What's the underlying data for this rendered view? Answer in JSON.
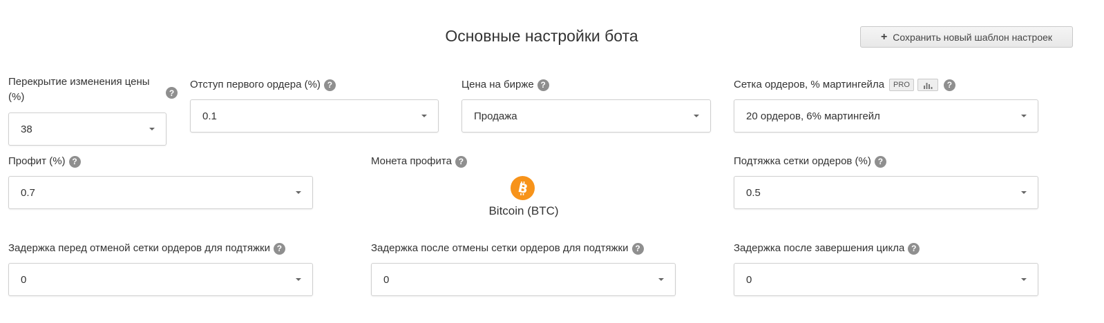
{
  "header": {
    "title": "Основные настройки бота",
    "save_button": "Сохранить новый шаблон настроек",
    "save_icon": "plus-icon"
  },
  "fields": {
    "overlap": {
      "label": "Перекрытие изменения цены (%)",
      "value": "38"
    },
    "first_order_offset": {
      "label": "Отступ первого ордера (%)",
      "value": "0.1"
    },
    "exchange_price": {
      "label": "Цена на бирже",
      "value": "Продажа"
    },
    "order_grid": {
      "label": "Сетка ордеров, % мартингейла",
      "badge": "PRO",
      "chart_icon": "bar-chart-icon",
      "value": "20 ордеров, 6% мартингейл"
    },
    "profit": {
      "label": "Профит (%)",
      "value": "0.7"
    },
    "profit_coin": {
      "label": "Монета профита",
      "coin_name": "Bitcoin (BTC)",
      "coin_icon": "bitcoin-icon",
      "coin_color": "#f7931a"
    },
    "grid_pullup": {
      "label": "Подтяжка сетки ордеров (%)",
      "value": "0.5"
    },
    "delay_before_cancel": {
      "label": "Задержка перед отменой сетки ордеров для подтяжки",
      "value": "0"
    },
    "delay_after_cancel": {
      "label": "Задержка после отмены сетки ордеров для подтяжки",
      "value": "0"
    },
    "delay_after_cycle": {
      "label": "Задержка после завершения цикла",
      "value": "0"
    }
  },
  "help_glyph": "?",
  "colors": {
    "help_icon": "#8f8f8f",
    "text": "#333333",
    "border": "#cfcfcf"
  }
}
